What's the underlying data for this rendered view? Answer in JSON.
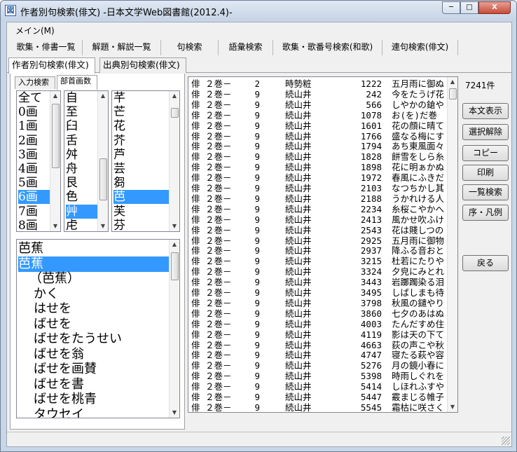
{
  "window": {
    "title": "作者別句検索(俳文) -日本文学Web図書館(2012.4)-",
    "app_icon": "図",
    "min": "─",
    "max": "□",
    "close": "X"
  },
  "menu": {
    "main": "メイン(M)"
  },
  "nav": [
    "歌集・俳書一覧",
    "解題・解説一覧",
    "句検索",
    "語彙検索",
    "歌集・歌番号検索(和歌)",
    "連句検索(俳文)"
  ],
  "subtabs": [
    "作者別句検索(俳文)",
    "出典別句検索(俳文)"
  ],
  "inner_tabs": [
    "入力検索",
    "部首画数"
  ],
  "strokes": {
    "items": [
      "全て",
      "0画",
      "1画",
      "2画",
      "3画",
      "4画",
      "5画",
      "6画",
      "7画",
      "8画"
    ],
    "selected": 7
  },
  "chars1": {
    "items": [
      "自",
      "至",
      "臼",
      "舌",
      "舛",
      "舟",
      "艮",
      "色",
      "艸",
      "虍"
    ],
    "selected": 8
  },
  "chars2": {
    "items": [
      "芊",
      "芒",
      "花",
      "芥",
      "芦",
      "芸",
      "芻",
      "芭",
      "芙",
      "芬"
    ],
    "selected": 7
  },
  "authors": {
    "items": [
      "芭蕉",
      "芭蕉",
      "（芭蕉）",
      "かく",
      "はせを",
      "ばせを",
      "ばせをたうせい",
      "ばせを翁",
      "ばせを画賛",
      "ばせを書",
      "ばせを桃青",
      "タウセイ"
    ],
    "selected": 1
  },
  "result_count": "7241件",
  "results": [
    [
      "俳",
      "２巻－",
      "2",
      "時勢粧",
      "1222",
      "五月雨に御ぬ"
    ],
    [
      "俳",
      "２巻－",
      "9",
      "続山井",
      "242",
      "今をたうげ花"
    ],
    [
      "俳",
      "２巻－",
      "9",
      "続山井",
      "566",
      "しやかの鎗や"
    ],
    [
      "俳",
      "２巻－",
      "9",
      "続山井",
      "1078",
      "お(を)だ巻"
    ],
    [
      "俳",
      "２巻－",
      "9",
      "続山井",
      "1601",
      "花の顔に晴て"
    ],
    [
      "俳",
      "２巻－",
      "9",
      "続山井",
      "1766",
      "盛なる梅にす"
    ],
    [
      "俳",
      "２巻－",
      "9",
      "続山井",
      "1794",
      "あち東風面々"
    ],
    [
      "俳",
      "２巻－",
      "9",
      "続山井",
      "1828",
      "餅雪をしら糸"
    ],
    [
      "俳",
      "２巻－",
      "9",
      "続山井",
      "1898",
      "花に明ぁかぬ"
    ],
    [
      "俳",
      "２巻－",
      "9",
      "続山井",
      "1972",
      "春風にふきだ"
    ],
    [
      "俳",
      "２巻－",
      "9",
      "続山井",
      "2103",
      "なつちかし其"
    ],
    [
      "俳",
      "２巻－",
      "9",
      "続山井",
      "2188",
      "うかれける人"
    ],
    [
      "俳",
      "２巻－",
      "9",
      "続山井",
      "2234",
      "糸桜こやかへ"
    ],
    [
      "俳",
      "２巻－",
      "9",
      "続山井",
      "2413",
      "風かせ吹ふけ"
    ],
    [
      "俳",
      "２巻－",
      "9",
      "続山井",
      "2543",
      "花は賤しつの"
    ],
    [
      "俳",
      "２巻－",
      "9",
      "続山井",
      "2925",
      "五月雨に御物"
    ],
    [
      "俳",
      "２巻－",
      "9",
      "続山井",
      "2937",
      "降ふる音おと"
    ],
    [
      "俳",
      "２巻－",
      "9",
      "続山井",
      "3215",
      "杜若にたりや"
    ],
    [
      "俳",
      "２巻－",
      "9",
      "続山井",
      "3324",
      "夕皃にみとれ"
    ],
    [
      "俳",
      "２巻－",
      "9",
      "続山井",
      "3443",
      "岩躑躅染る泪"
    ],
    [
      "俳",
      "２巻－",
      "9",
      "続山井",
      "3495",
      "しばしまも待"
    ],
    [
      "俳",
      "２巻－",
      "9",
      "続山井",
      "3798",
      "秋風の鑓やり"
    ],
    [
      "俳",
      "２巻－",
      "9",
      "続山井",
      "3860",
      "七夕のあはぬ"
    ],
    [
      "俳",
      "２巻－",
      "9",
      "続山井",
      "4003",
      "たんだすめ住"
    ],
    [
      "俳",
      "２巻－",
      "9",
      "続山井",
      "4119",
      "影は天の下て"
    ],
    [
      "俳",
      "２巻－",
      "9",
      "続山井",
      "4663",
      "荻の声こや秋"
    ],
    [
      "俳",
      "２巻－",
      "9",
      "続山井",
      "4747",
      "寝たる萩や容"
    ],
    [
      "俳",
      "２巻－",
      "9",
      "続山井",
      "5276",
      "月の鏡小春に"
    ],
    [
      "俳",
      "２巻－",
      "9",
      "続山井",
      "5398",
      "時雨しぐれを"
    ],
    [
      "俳",
      "２巻－",
      "9",
      "続山井",
      "5414",
      "しほれふすや"
    ],
    [
      "俳",
      "２巻－",
      "9",
      "続山井",
      "5447",
      "霰まじる帷子"
    ],
    [
      "俳",
      "２巻－",
      "9",
      "続山井",
      "5545",
      "霜枯に咲さく"
    ]
  ],
  "buttons": [
    "本文表示",
    "選択解除",
    "コピー",
    "印刷",
    "一覧検索",
    "序・凡例",
    "戻る"
  ],
  "scroll": {
    "up": "▲",
    "down": "▼"
  }
}
